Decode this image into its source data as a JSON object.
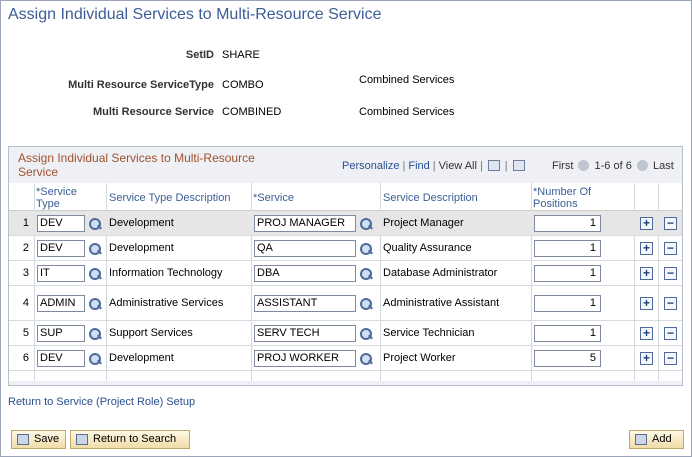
{
  "page": {
    "title": "Assign Individual Services to Multi-Resource Service"
  },
  "header": {
    "setid_label": "SetID",
    "setid_value": "SHARE",
    "type_label": "Multi Resource ServiceType",
    "type_value": "COMBO",
    "type_desc": "Combined Services",
    "service_label": "Multi Resource Service",
    "service_value": "COMBINED",
    "service_desc": "Combined Services"
  },
  "grid": {
    "title": "Assign Individual Services to Multi-Resource Service",
    "personalize": "Personalize",
    "find": "Find",
    "view_all": "View All",
    "first": "First",
    "range": "1-6 of 6",
    "last": "Last",
    "columns": {
      "service_type": "*Service Type",
      "service_type_desc": "Service Type Description",
      "service": "*Service",
      "service_desc": "Service Description",
      "positions": "*Number Of Positions"
    },
    "rows": [
      {
        "num": "1",
        "type": "DEV",
        "type_desc": "Development",
        "service": "PROJ MANAGER",
        "service_desc": "Project Manager",
        "positions": "1"
      },
      {
        "num": "2",
        "type": "DEV",
        "type_desc": "Development",
        "service": "QA",
        "service_desc": "Quality Assurance",
        "positions": "1"
      },
      {
        "num": "3",
        "type": "IT",
        "type_desc": "Information Technology",
        "service": "DBA",
        "service_desc": "Database Administrator",
        "positions": "1"
      },
      {
        "num": "4",
        "type": "ADMIN",
        "type_desc": "Administrative Services",
        "service": "ASSISTANT",
        "service_desc": "Administrative Assistant",
        "positions": "1"
      },
      {
        "num": "5",
        "type": "SUP",
        "type_desc": "Support Services",
        "service": "SERV TECH",
        "service_desc": "Service Technician",
        "positions": "1"
      },
      {
        "num": "6",
        "type": "DEV",
        "type_desc": "Development",
        "service": "PROJ WORKER",
        "service_desc": "Project Worker",
        "positions": "5"
      }
    ]
  },
  "links": {
    "return_setup": "Return to Service (Project Role) Setup"
  },
  "toolbar": {
    "save_label": "Save",
    "return_search_label": "Return to Search",
    "add_label": "Add"
  }
}
